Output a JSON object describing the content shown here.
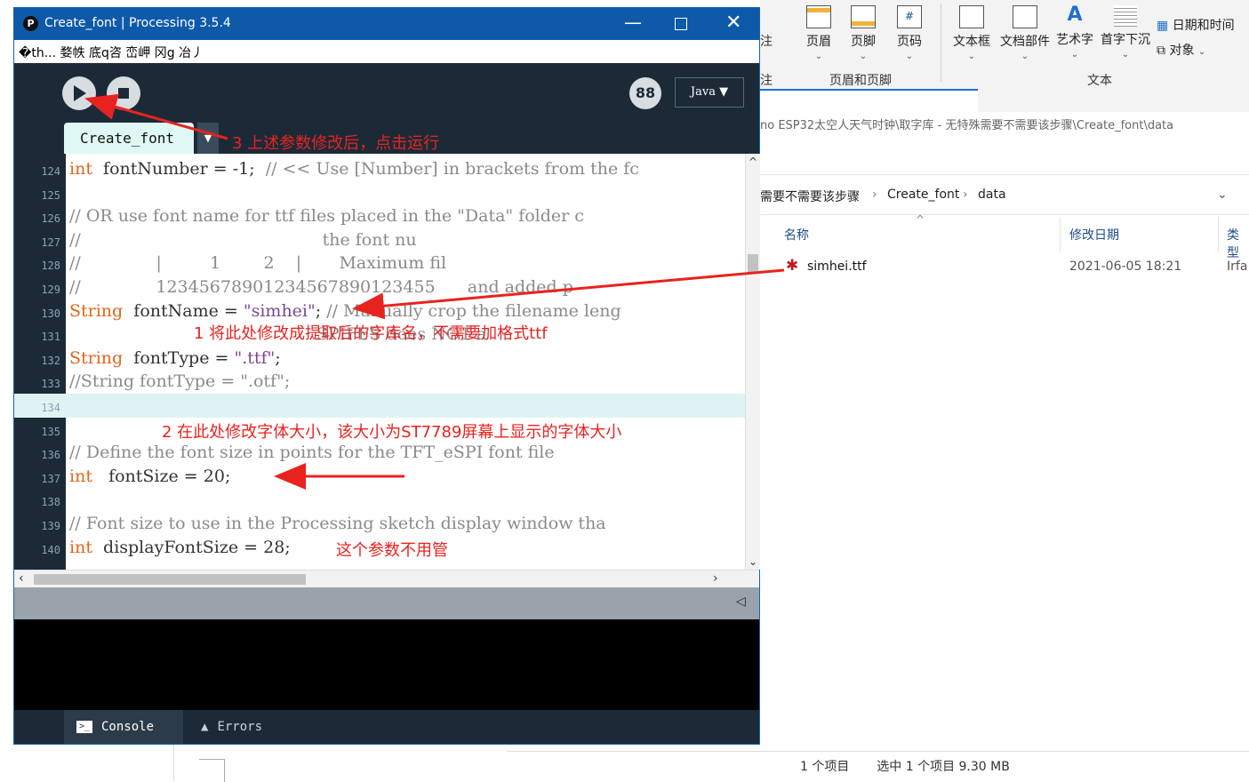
{
  "ribbon": {
    "buttons": [
      {
        "label": "页眉",
        "icon": "header-icon"
      },
      {
        "label": "页脚",
        "icon": "footer-icon"
      },
      {
        "label": "页码",
        "icon": "page-number-icon"
      },
      {
        "label": "文本框",
        "icon": "textbox-icon"
      },
      {
        "label": "文档部件",
        "icon": "quick-parts-icon"
      },
      {
        "label": "艺术字",
        "icon": "wordart-icon"
      },
      {
        "label": "首字下沉",
        "icon": "dropcap-icon"
      }
    ],
    "small_buttons": [
      {
        "label": "日期和时间",
        "icon": "calendar-icon"
      },
      {
        "label": "对象",
        "icon": "object-icon"
      }
    ],
    "groups": [
      "页眉和页脚",
      "文本"
    ],
    "cut_left_labels": [
      "注",
      "注"
    ]
  },
  "explorer": {
    "address": "no ESP32太空人天气时钟\\取字库 - 无特殊需要不需要该步骤\\Create_font\\data",
    "breadcrumb": [
      "需要不需要该步骤",
      "Create_font",
      "data"
    ],
    "columns": [
      "名称",
      "修改日期",
      "类型"
    ],
    "files": [
      {
        "name": "simhei.ttf",
        "date": "2021-06-05 18:21",
        "type": "Irfa"
      }
    ],
    "status": {
      "count": "1 个项目",
      "selected": "选中 1 个项目  9.30 MB"
    }
  },
  "processing": {
    "title": "Create_font | Processing 3.5.4",
    "menu": "�th... 婺帙 底q咨 峦岬 冈g 冶丿",
    "mode": "Java ▼",
    "tab": "Create_font",
    "console_tabs": [
      "Console",
      "Errors"
    ],
    "lines": [
      {
        "n": "124",
        "segs": [
          [
            "kw",
            "int"
          ],
          [
            "",
            "  fontNumber = -1;  "
          ],
          [
            "cm",
            "// << Use [Number] in brackets from the fc"
          ]
        ]
      },
      {
        "n": "125",
        "segs": [
          [
            "",
            ""
          ]
        ]
      },
      {
        "n": "126",
        "segs": [
          [
            "cm",
            "// OR use font name for ttf files placed in the \"Data\" folder c"
          ]
        ]
      },
      {
        "n": "127",
        "segs": [
          [
            "cm",
            "//                                             the font nu"
          ]
        ]
      },
      {
        "n": "128",
        "segs": [
          [
            "cm",
            "//              |         1        2    |       Maximum fil"
          ]
        ]
      },
      {
        "n": "129",
        "segs": [
          [
            "cm",
            "//              12345678901234567890123455      and added p"
          ]
        ]
      },
      {
        "n": "130",
        "segs": [
          [
            "kw",
            "String"
          ],
          [
            "",
            "  fontName = "
          ],
          [
            "st",
            "\"simhei\""
          ],
          [
            "",
            "; "
          ],
          [
            "cm",
            "// Manually crop the filename leng"
          ]
        ]
      },
      {
        "n": "131",
        "segs": [
          [
            "cm",
            "                                              SPIFFS does NOT a"
          ]
        ]
      },
      {
        "n": "132",
        "segs": [
          [
            "kw",
            "String"
          ],
          [
            "",
            "  fontType = "
          ],
          [
            "st",
            "\".ttf\""
          ],
          [
            "",
            ";"
          ]
        ]
      },
      {
        "n": "133",
        "segs": [
          [
            "cm",
            "//String fontType = \".otf\";"
          ]
        ]
      },
      {
        "n": "134",
        "segs": [
          [
            "",
            ""
          ]
        ],
        "highlight": true
      },
      {
        "n": "135",
        "segs": [
          [
            "",
            ""
          ]
        ]
      },
      {
        "n": "136",
        "segs": [
          [
            "cm",
            "// Define the font size in points for the TFT_eSPI font file"
          ]
        ]
      },
      {
        "n": "137",
        "segs": [
          [
            "kw",
            "int"
          ],
          [
            "",
            "   fontSize = 20;"
          ]
        ]
      },
      {
        "n": "138",
        "segs": [
          [
            "",
            ""
          ]
        ]
      },
      {
        "n": "139",
        "segs": [
          [
            "cm",
            "// Font size to use in the Processing sketch display window tha"
          ]
        ]
      },
      {
        "n": "140",
        "segs": [
          [
            "kw",
            "int"
          ],
          [
            "",
            "  displayFontSize = 28;"
          ]
        ]
      }
    ]
  },
  "annotations": {
    "a1": "1 将此处修改成提取后的字库名，不需要加格式ttf",
    "a2": "2 在此处修改字体大小，该大小为ST7789屏幕上显示的字体大小",
    "a3": "3 上述参数修改后，点击运行",
    "a4": "这个参数不用管"
  },
  "colors": {
    "title_bar": "#0e5aa9",
    "editor_dark": "#1c2a38",
    "keyword": "#e2661a",
    "annotation": "#e8231f"
  }
}
